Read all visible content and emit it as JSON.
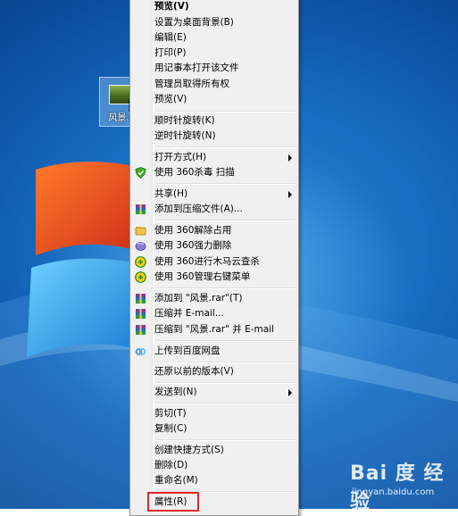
{
  "desktop": {
    "file": {
      "label": "风景.r"
    }
  },
  "menu": {
    "items": [
      {
        "label": "预览(V)",
        "bold": true,
        "icon": null
      },
      {
        "label": "设置为桌面背景(B)",
        "icon": null
      },
      {
        "label": "编辑(E)",
        "icon": null
      },
      {
        "label": "打印(P)",
        "icon": null
      },
      {
        "label": "用记事本打开该文件",
        "icon": null
      },
      {
        "label": "管理员取得所有权",
        "icon": null
      },
      {
        "label": "预览(V)",
        "icon": null
      },
      {
        "label": "顺时针旋转(K)",
        "icon": null
      },
      {
        "label": "逆时针旋转(N)",
        "icon": null
      },
      {
        "label": "打开方式(H)",
        "icon": null,
        "submenu": true
      },
      {
        "label": "使用 360杀毒 扫描",
        "icon": "360-antivirus-icon"
      },
      {
        "label": "共享(H)",
        "icon": null,
        "submenu": true
      },
      {
        "label": "添加到压缩文件(A)...",
        "icon": "winrar-icon"
      },
      {
        "label": "使用 360解除占用",
        "icon": "360-unlock-icon"
      },
      {
        "label": "使用 360强力删除",
        "icon": "360-delete-icon"
      },
      {
        "label": "使用 360进行木马云查杀",
        "icon": "360-trojan-scan-icon"
      },
      {
        "label": "使用 360管理右键菜单",
        "icon": "360-menu-manager-icon"
      },
      {
        "label": "添加到 \"风景.rar\"(T)",
        "icon": "winrar-icon"
      },
      {
        "label": "压缩并 E-mail...",
        "icon": "winrar-icon"
      },
      {
        "label": "压缩到 \"风景.rar\" 并 E-mail",
        "icon": "winrar-icon"
      },
      {
        "label": "上传到百度网盘",
        "icon": "baidu-netdisk-icon"
      },
      {
        "label": "还原以前的版本(V)",
        "icon": null
      },
      {
        "label": "发送到(N)",
        "icon": null,
        "submenu": true
      },
      {
        "label": "剪切(T)",
        "icon": null
      },
      {
        "label": "复制(C)",
        "icon": null
      },
      {
        "label": "创建快捷方式(S)",
        "icon": null
      },
      {
        "label": "删除(D)",
        "icon": null
      },
      {
        "label": "重命名(M)",
        "icon": null
      },
      {
        "label": "属性(R)",
        "icon": null
      }
    ]
  },
  "watermark": {
    "logo": "Bai 度 经验",
    "url": "jingyan.baidu.com"
  },
  "colors": {
    "highlight": "#e3262a",
    "menu_bg": "#f0f0f0"
  }
}
